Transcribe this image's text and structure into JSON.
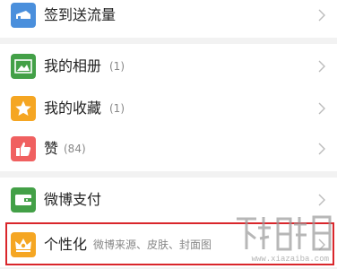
{
  "menu": {
    "signin": {
      "label": "签到送流量",
      "icon": "ticket-icon",
      "color": "#4a8fdc"
    },
    "album": {
      "label": "我的相册",
      "count": "(1)",
      "icon": "photo-icon",
      "color": "#43a047"
    },
    "favorites": {
      "label": "我的收藏",
      "count": "(1)",
      "icon": "star-icon",
      "color": "#f5a623"
    },
    "likes": {
      "label": "赞",
      "count": "(84)",
      "icon": "thumbs-up-icon",
      "color": "#f06060"
    },
    "pay": {
      "label": "微博支付",
      "icon": "wallet-icon",
      "color": "#43a047"
    },
    "personalize": {
      "label": "个性化",
      "sub": "微博来源、皮肤、封面图",
      "icon": "crown-icon",
      "color": "#f5a623"
    }
  },
  "highlight_color": "#d9262b",
  "watermark": {
    "text": "www.xiazaiba.com"
  }
}
